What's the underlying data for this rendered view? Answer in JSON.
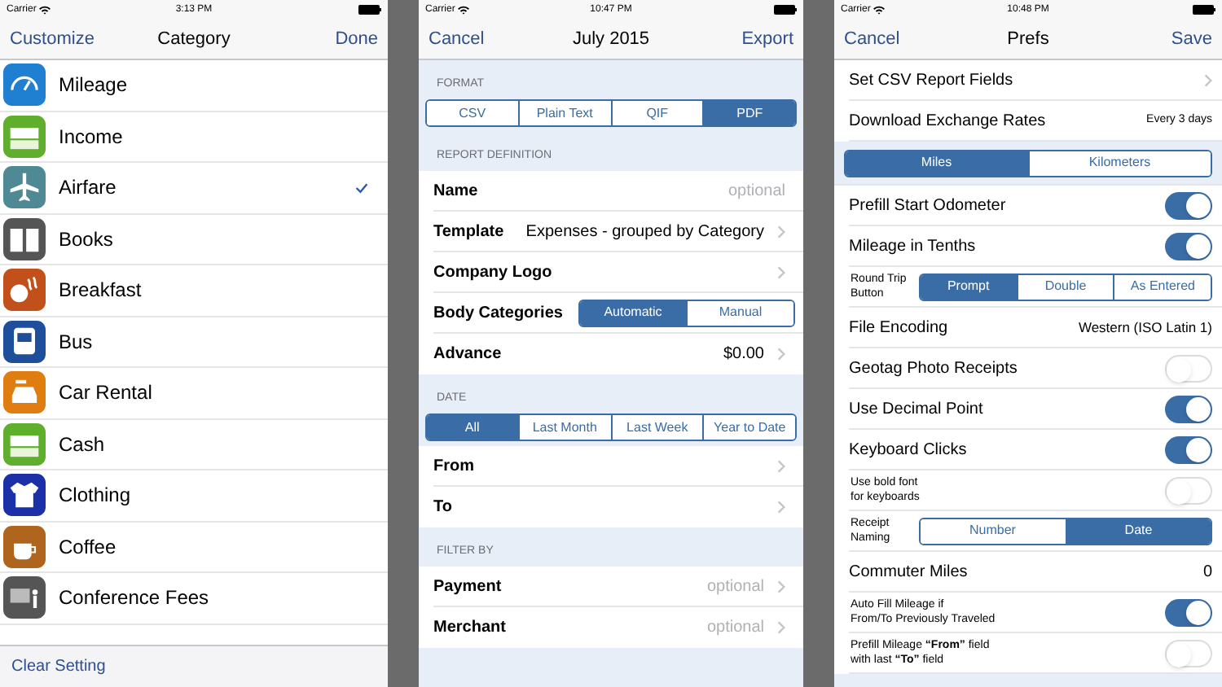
{
  "screens": [
    {
      "status_bar": {
        "carrier": "Carrier",
        "time": "3:13 PM"
      },
      "nav": {
        "left": "Customize",
        "title": "Category",
        "right": "Done"
      },
      "categories": [
        {
          "label": "Mileage",
          "kind": "gauge",
          "color": "#1f7fd0",
          "selected": false
        },
        {
          "label": "Income",
          "kind": "cash",
          "color": "#5fae2e",
          "selected": false
        },
        {
          "label": "Airfare",
          "kind": "plane",
          "color": "#4f8a94",
          "selected": true
        },
        {
          "label": "Books",
          "kind": "book",
          "color": "#555555",
          "selected": false
        },
        {
          "label": "Breakfast",
          "kind": "egg",
          "color": "#c2501a",
          "selected": false
        },
        {
          "label": "Bus",
          "kind": "bus",
          "color": "#1f4f9a",
          "selected": false
        },
        {
          "label": "Car Rental",
          "kind": "car",
          "color": "#e07d10",
          "selected": false
        },
        {
          "label": "Cash",
          "kind": "cash",
          "color": "#5fae2e",
          "selected": false
        },
        {
          "label": "Clothing",
          "kind": "shirt",
          "color": "#1a2fa8",
          "selected": false
        },
        {
          "label": "Coffee",
          "kind": "cup",
          "color": "#b0651e",
          "selected": false
        },
        {
          "label": "Conference Fees",
          "kind": "screen",
          "color": "#555555",
          "selected": false
        }
      ],
      "toolbar": {
        "button": "Clear Setting"
      }
    },
    {
      "status_bar": {
        "carrier": "Carrier",
        "time": "10:47 PM"
      },
      "nav": {
        "left": "Cancel",
        "title": "July 2015",
        "right": "Export"
      },
      "sections": [
        {
          "header": "FORMAT",
          "segments": [
            {
              "label": "CSV",
              "selected": false
            },
            {
              "label": "Plain Text",
              "selected": false
            },
            {
              "label": "QIF",
              "selected": false
            },
            {
              "label": "PDF",
              "selected": true
            }
          ]
        },
        {
          "header": "REPORT DEFINITION",
          "rows": [
            {
              "kind": "field",
              "label": "Name",
              "placeholder": "optional"
            },
            {
              "kind": "disclosure",
              "label": "Template",
              "value": "Expenses - grouped by Category"
            },
            {
              "kind": "disclosure",
              "label": "Company Logo"
            },
            {
              "kind": "segmented",
              "label": "Body Categories",
              "segments": [
                {
                  "label": "Automatic",
                  "selected": true
                },
                {
                  "label": "Manual",
                  "selected": false
                }
              ]
            },
            {
              "kind": "disclosure",
              "label": "Advance",
              "value": "$0.00"
            }
          ]
        },
        {
          "header": "DATE",
          "segments": [
            {
              "label": "All",
              "selected": true
            },
            {
              "label": "Last Month",
              "selected": false
            },
            {
              "label": "Last Week",
              "selected": false
            },
            {
              "label": "Year to Date",
              "selected": false
            }
          ],
          "rows": [
            {
              "kind": "disclosure",
              "label": "From"
            },
            {
              "kind": "disclosure",
              "label": "To"
            }
          ]
        },
        {
          "header": "FILTER BY",
          "rows": [
            {
              "kind": "disclosure",
              "label": "Payment",
              "placeholder": "optional"
            },
            {
              "kind": "disclosure",
              "label": "Merchant",
              "placeholder": "optional"
            }
          ]
        }
      ]
    },
    {
      "status_bar": {
        "carrier": "Carrier",
        "time": "10:48 PM"
      },
      "nav": {
        "left": "Cancel",
        "title": "Prefs",
        "right": "Save"
      },
      "rows": [
        {
          "kind": "disclosure",
          "label": "Set CSV Report Fields"
        },
        {
          "kind": "value",
          "label": "Download Exchange Rates",
          "value": "Every 3 days"
        },
        {
          "kind": "segmented",
          "segments": [
            {
              "label": "Miles",
              "selected": true
            },
            {
              "label": "Kilometers",
              "selected": false
            }
          ]
        },
        {
          "kind": "toggle",
          "label": "Prefill Start Odometer",
          "on": true
        },
        {
          "kind": "toggle",
          "label": "Mileage in Tenths",
          "on": true
        },
        {
          "kind": "segmented",
          "label": "Round Trip\nButton",
          "segments": [
            {
              "label": "Prompt",
              "selected": true
            },
            {
              "label": "Double",
              "selected": false
            },
            {
              "label": "As Entered",
              "selected": false
            }
          ]
        },
        {
          "kind": "value",
          "label": "File Encoding",
          "value": "Western (ISO Latin 1)"
        },
        {
          "kind": "toggle",
          "label": "Geotag Photo Receipts",
          "on": false
        },
        {
          "kind": "toggle",
          "label": "Use Decimal Point",
          "on": true
        },
        {
          "kind": "toggle",
          "label": "Keyboard Clicks",
          "on": true
        },
        {
          "kind": "small_toggle",
          "label": "Use bold font\nfor keyboards",
          "on": false
        },
        {
          "kind": "segmented",
          "label": "Receipt\nNaming",
          "segments": [
            {
              "label": "Number",
              "selected": false
            },
            {
              "label": "Date",
              "selected": true
            }
          ]
        },
        {
          "kind": "value",
          "label": "Commuter Miles",
          "value": "0"
        },
        {
          "kind": "small_toggle",
          "label": "Auto Fill Mileage if\nFrom/To Previously Traveled",
          "on": true
        },
        {
          "kind": "small_toggle",
          "label": "Prefill Mileage **“From”** field\nwith last **“To”** field",
          "on": false
        }
      ]
    }
  ]
}
